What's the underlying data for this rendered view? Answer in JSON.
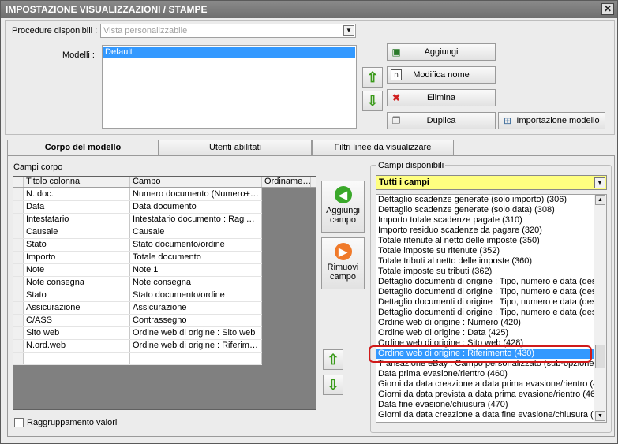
{
  "window": {
    "title": "IMPOSTAZIONE VISUALIZZAZIONI / STAMPE",
    "close": "✕"
  },
  "top": {
    "procedure_label": "Procedure disponibili :",
    "procedure_value": "Vista personalizzabile",
    "modelli_label": "Modelli :",
    "modelli": [
      "Default"
    ],
    "buttons": {
      "aggiungi": "Aggiungi",
      "modifica": "Modifica nome",
      "elimina": "Elimina",
      "duplica": "Duplica",
      "importazione": "Importazione modello"
    }
  },
  "tabs": [
    "Corpo del modello",
    "Utenti abilitati",
    "Filtri linee da visualizzare"
  ],
  "corpo": {
    "group_label": "Campi corpo",
    "headers": [
      "Titolo colonna",
      "Campo",
      "Ordiname…"
    ],
    "rows": [
      [
        "N. doc.",
        "Numero documento (Numero+…"
      ],
      [
        "Data",
        "Data documento"
      ],
      [
        "Intestatario",
        "Intestatario documento : Ragi…"
      ],
      [
        "Causale",
        "Causale"
      ],
      [
        "Stato",
        "Stato documento/ordine"
      ],
      [
        "Importo",
        "Totale documento"
      ],
      [
        "Note",
        "Note 1"
      ],
      [
        "Note consegna",
        "Note consegna"
      ],
      [
        "Stato",
        "Stato documento/ordine"
      ],
      [
        "Assicurazione",
        "Assicurazione"
      ],
      [
        "C/ASS",
        "Contrassegno"
      ],
      [
        "Sito web",
        "Ordine web di origine : Sito web"
      ],
      [
        "N.ord.web",
        "Ordine web di origine : Riferim…"
      ],
      [
        "",
        ""
      ]
    ],
    "aggiungi_campo": "Aggiungi campo",
    "rimuovi_campo": "Rimuovi campo",
    "raggruppamento": "Raggruppamento valori"
  },
  "disponibili": {
    "group_label": "Campi disponibili",
    "filter_value": "Tutti i campi",
    "items": [
      "Dettaglio scadenze generate (solo importo) (306)",
      "Dettaglio scadenze generate (solo data) (308)",
      "Importo totale scadenze pagate (310)",
      "Importo residuo scadenze da pagare (320)",
      "Totale ritenute al netto delle imposte (350)",
      "Totale imposte su ritenute (352)",
      "Totale tributi al netto delle imposte (360)",
      "Totale imposte su tributi (362)",
      "Dettaglio documenti di origine : Tipo, numero e data (des",
      "Dettaglio documenti di origine : Tipo, numero e data (des",
      "Dettaglio documenti di origine : Tipo, numero e data (des",
      "Dettaglio documenti di origine : Tipo, numero e data (des",
      "Ordine web di origine : Numero (420)",
      "Ordine web di origine : Data (425)",
      "Ordine web di origine : Sito web (428)",
      "Ordine web di origine : Riferimento (430)",
      "Transazione eBay : Campo personalizzato (sub-opzione)",
      "Data prima evasione/rientro (460)",
      "Giorni da data creazione a data prima evasione/rientro (4",
      "Giorni da data prevista a data prima evasione/rientro (46",
      "Data fine evasione/chiusura (470)",
      "Giorni da data creazione a data fine evasione/chiusura (4"
    ],
    "selected_index": 15
  }
}
